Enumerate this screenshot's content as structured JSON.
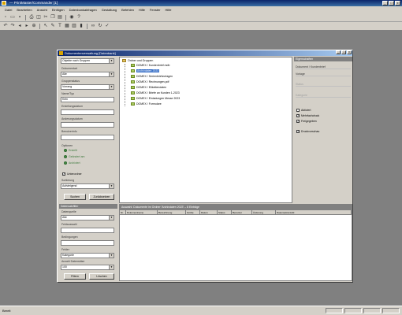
{
  "app": {
    "title": "— PrintMaster/Commander [1]",
    "win_min": "_",
    "win_max": "□",
    "win_close": "x"
  },
  "menu": [
    "Datei",
    "Bearbeiten",
    "Ansicht",
    "Einfügen",
    "Datenbankabfragen",
    "Gestaltung",
    "Befehlen",
    "Hilfe",
    "Fenster",
    "Hilfe"
  ],
  "statusbar": {
    "left": "Bereit",
    "panels": [
      "",
      "",
      "",
      ""
    ]
  },
  "child": {
    "title": "Dokumentenverwaltung [Datenbank]",
    "left_top": {
      "combo1": "Objekte nach Gruppen",
      "label_type": "Dokumentart",
      "combo_type": "Alle",
      "label_status": "Gruppenstatus",
      "combo_status": "Vorrang",
      "label_name": "Name/Typ",
      "field_name": "Kein",
      "label_begin": "Erstellungsdatum",
      "label_end": "Änderungsdatum",
      "label_author": "Benutzerinfo",
      "label_options": "Optionen",
      "radio1": "Erstellt",
      "radio2": "Geändert am",
      "radio3": "Archiviert",
      "checkbox_label": "Unterordner",
      "label_sort": "Sortierung",
      "combo_sort": "Aufsteigend",
      "btn_search": "Suchen",
      "btn_reset": "Zurücksetzen"
    },
    "tree": {
      "root": "Ordner und Gruppen",
      "items": [
        {
          "label": "DOMEX / Kundenbrief.mdb",
          "selected": false
        },
        {
          "label": "Archivdaten 2023",
          "selected": true
        },
        {
          "label": "DOMEX / Serienbriefvorlagen",
          "selected": false
        },
        {
          "label": "DOMEX / Rechnungen.pdf",
          "selected": false
        },
        {
          "label": "DOMEX / Etikettendaten",
          "selected": false
        },
        {
          "label": "DOMEX / Briefe an Kunden 1-2023",
          "selected": false
        },
        {
          "label": "DOMEX / Einladungen Messe 2023",
          "selected": false
        },
        {
          "label": "DOMEX / Formulare",
          "selected": false
        }
      ]
    },
    "right": {
      "header": "Eigenschaften",
      "f1": "Dokument / Kundenbrief",
      "f2": "Vorlage",
      "f3": "Status",
      "f4": "Kategorie",
      "chk1": "Aktiviert",
      "chk2": "Mehrfachdruck",
      "chk3": "Freigegeben",
      "chk4": "Druckvorschau"
    },
    "left_bottom": {
      "header": "Datensatzfilter",
      "label_a": "Datenquelle",
      "combo_a": "Alle",
      "label_b": "Feldauswahl",
      "label_c": "Bedingungen",
      "label_d": "Felder",
      "combo_d": "Kategorie",
      "label_e": "Anzahl Datensätze",
      "combo_e": "100",
      "btn_ok": "Filtern",
      "btn_clear": "Löschen"
    },
    "grid": {
      "bar": "Auswahl: Dokumente im Ordner 'Archivdaten 2023' – 8 Einträge",
      "columns": [
        "Nr.",
        "Dokumentname",
        "Bezeichnung",
        "Größe",
        "Datum",
        "Status",
        "Benutzer",
        "Änderung",
        "Datensatzanzahl"
      ]
    }
  }
}
